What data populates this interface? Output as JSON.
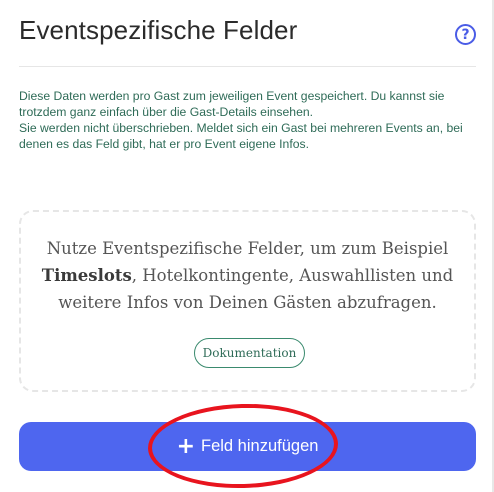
{
  "header": {
    "title": "Eventspezifische Felder",
    "help_glyph": "?"
  },
  "description": {
    "line1": "Diese Daten werden pro Gast zum jeweiligen Event gespeichert. Du kannst sie trotzdem ganz einfach über die Gast-Details einsehen.",
    "line2": "Sie werden nicht überschrieben. Meldet sich ein Gast bei mehreren Events an, bei denen es das Feld gibt, hat er pro Event eigene Infos."
  },
  "empty_state": {
    "text_before": "Nutze Eventspezifische Felder, um zum Beispiel ",
    "text_bold": "Timeslots",
    "text_after": ", Hotelkontingente, Auswahllisten und weitere Infos von Deinen Gästen abzufragen.",
    "doc_button_label": "Dokumentation"
  },
  "actions": {
    "add_icon": "+",
    "add_label": "Feld hinzufügen"
  },
  "colors": {
    "accent_blue": "#4e66ef",
    "text_green": "#2e6b57",
    "annotation_red": "#e8141e"
  },
  "icons": {
    "help": "question-circle-icon",
    "add": "plus-icon"
  }
}
